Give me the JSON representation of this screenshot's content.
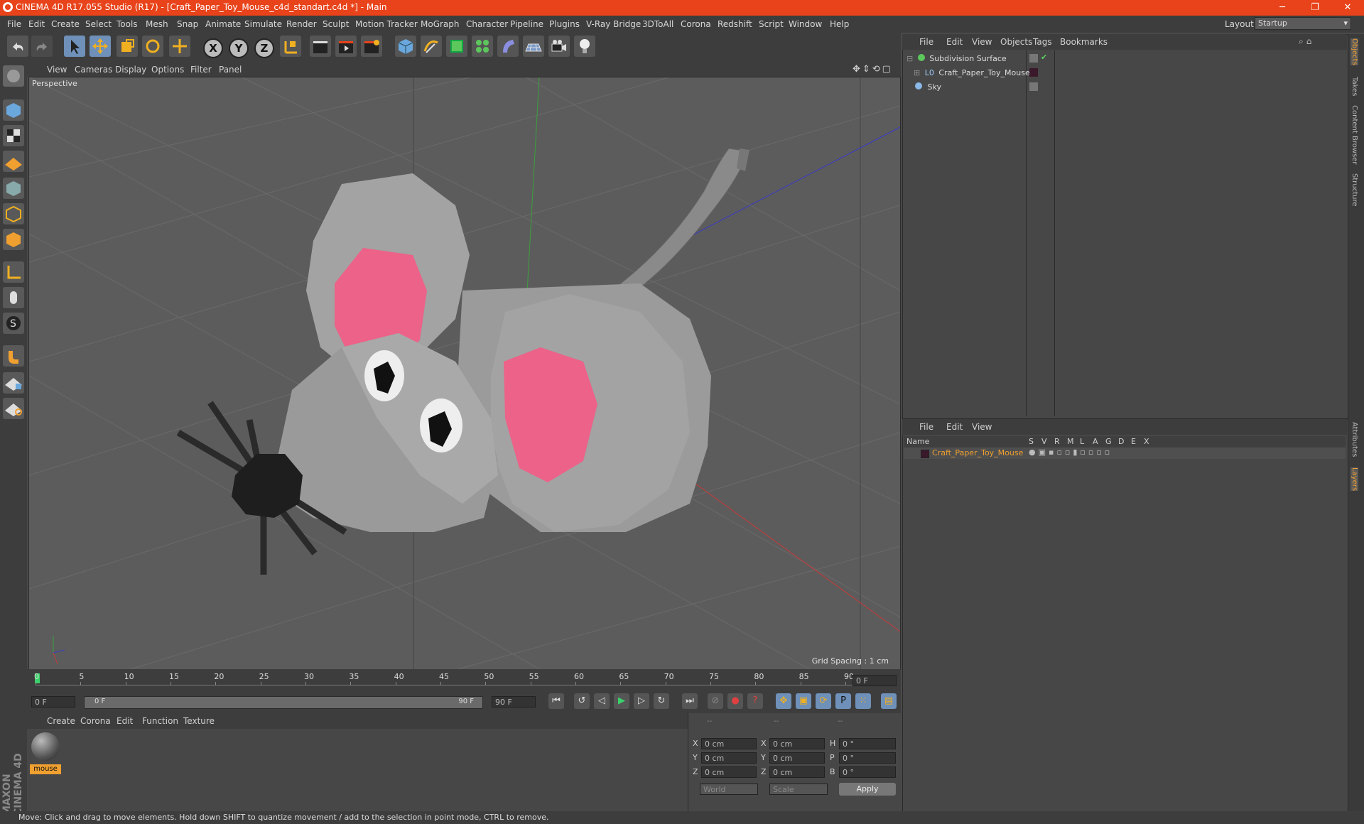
{
  "window": {
    "title": "CINEMA 4D R17.055 Studio (R17) - [Craft_Paper_Toy_Mouse_c4d_standart.c4d *] - Main",
    "minimize": "─",
    "restore": "❐",
    "close": "✕"
  },
  "menu": [
    "File",
    "Edit",
    "Create",
    "Select",
    "Tools",
    "Mesh",
    "Snap",
    "Animate",
    "Simulate",
    "Render",
    "Sculpt",
    "Motion Tracker",
    "MoGraph",
    "Character",
    "Pipeline",
    "Plugins",
    "V-Ray Bridge",
    "3DToAll",
    "Corona",
    "Redshift",
    "Script",
    "Window",
    "Help"
  ],
  "layout": {
    "label": "Layout:",
    "value": "Startup"
  },
  "toolbar": {
    "x": "X",
    "y": "Y",
    "z": "Z"
  },
  "viewport": {
    "menu": [
      "View",
      "Cameras",
      "Display",
      "Options",
      "Filter",
      "Panel"
    ],
    "label": "Perspective",
    "grid_spacing": "Grid Spacing : 1 cm"
  },
  "timeline": {
    "ticks": [
      "0",
      "5",
      "10",
      "15",
      "20",
      "25",
      "30",
      "35",
      "40",
      "45",
      "50",
      "55",
      "60",
      "65",
      "70",
      "75",
      "80",
      "85",
      "90"
    ],
    "current_frame": "0 F",
    "start_frame": "0 F",
    "range_start": "0 F",
    "range_end": "90 F",
    "end_frame": "90 F"
  },
  "material_manager": {
    "menu": [
      "Create",
      "Corona",
      "Edit",
      "Function",
      "Texture"
    ],
    "materials": [
      {
        "name": "mouse"
      }
    ]
  },
  "coordinates": {
    "headers": [
      "--",
      "--",
      "--"
    ],
    "rows": [
      {
        "a": "X",
        "av": "0 cm",
        "b": "X",
        "bv": "0 cm",
        "c": "H",
        "cv": "0 °"
      },
      {
        "a": "Y",
        "av": "0 cm",
        "b": "Y",
        "bv": "0 cm",
        "c": "P",
        "cv": "0 °"
      },
      {
        "a": "Z",
        "av": "0 cm",
        "b": "Z",
        "bv": "0 cm",
        "c": "B",
        "cv": "0 °"
      }
    ],
    "world": "World",
    "scale": "Scale",
    "apply": "Apply"
  },
  "object_manager": {
    "menu": [
      "File",
      "Edit",
      "View",
      "Objects",
      "Tags",
      "Bookmarks"
    ],
    "objects": [
      {
        "name": "Subdivision Surface"
      },
      {
        "name": "Craft_Paper_Toy_Mouse"
      },
      {
        "name": "Sky"
      }
    ]
  },
  "layer_manager": {
    "menu": [
      "File",
      "Edit",
      "View"
    ],
    "name_header": "Name",
    "columns": [
      "S",
      "V",
      "R",
      "M",
      "L",
      "A",
      "G",
      "D",
      "E",
      "X"
    ],
    "layers": [
      {
        "name": "Craft_Paper_Toy_Mouse"
      }
    ]
  },
  "side_tabs": [
    "Objects",
    "Takes",
    "Content Browser",
    "Structure",
    "Attributes",
    "Layers"
  ],
  "brand": "MAXON CINEMA 4D",
  "status": "Move: Click and drag to move elements. Hold down SHIFT to quantize movement / add to the selection in point mode, CTRL to remove.",
  "colors": {
    "accent": "#e8431a",
    "layer_highlight": "#f0a030",
    "ear_pink": "#ec6288"
  }
}
